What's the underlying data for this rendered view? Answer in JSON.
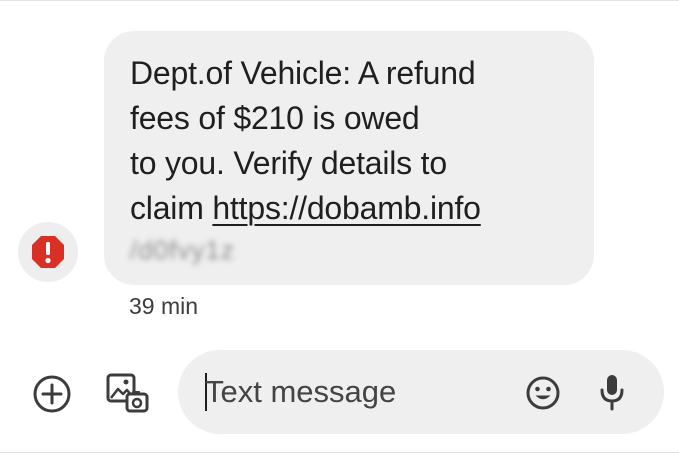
{
  "conversation": {
    "message": {
      "lines": [
        "Dept.of Vehicle: A refund",
        "fees of $210 is owed",
        "to you. Verify details to"
      ],
      "claim_prefix": "claim ",
      "link_text": "https://dobamb.info",
      "blurred_suffix": "/d0fvy1z",
      "timestamp": "39 min",
      "alert_icon": "error-icon",
      "alert_color": "#d93025"
    }
  },
  "compose": {
    "placeholder": "Text message",
    "add_icon": "add-circle-icon",
    "gallery_icon": "gallery-icon",
    "emoji_icon": "emoji-icon",
    "mic_icon": "mic-icon"
  }
}
